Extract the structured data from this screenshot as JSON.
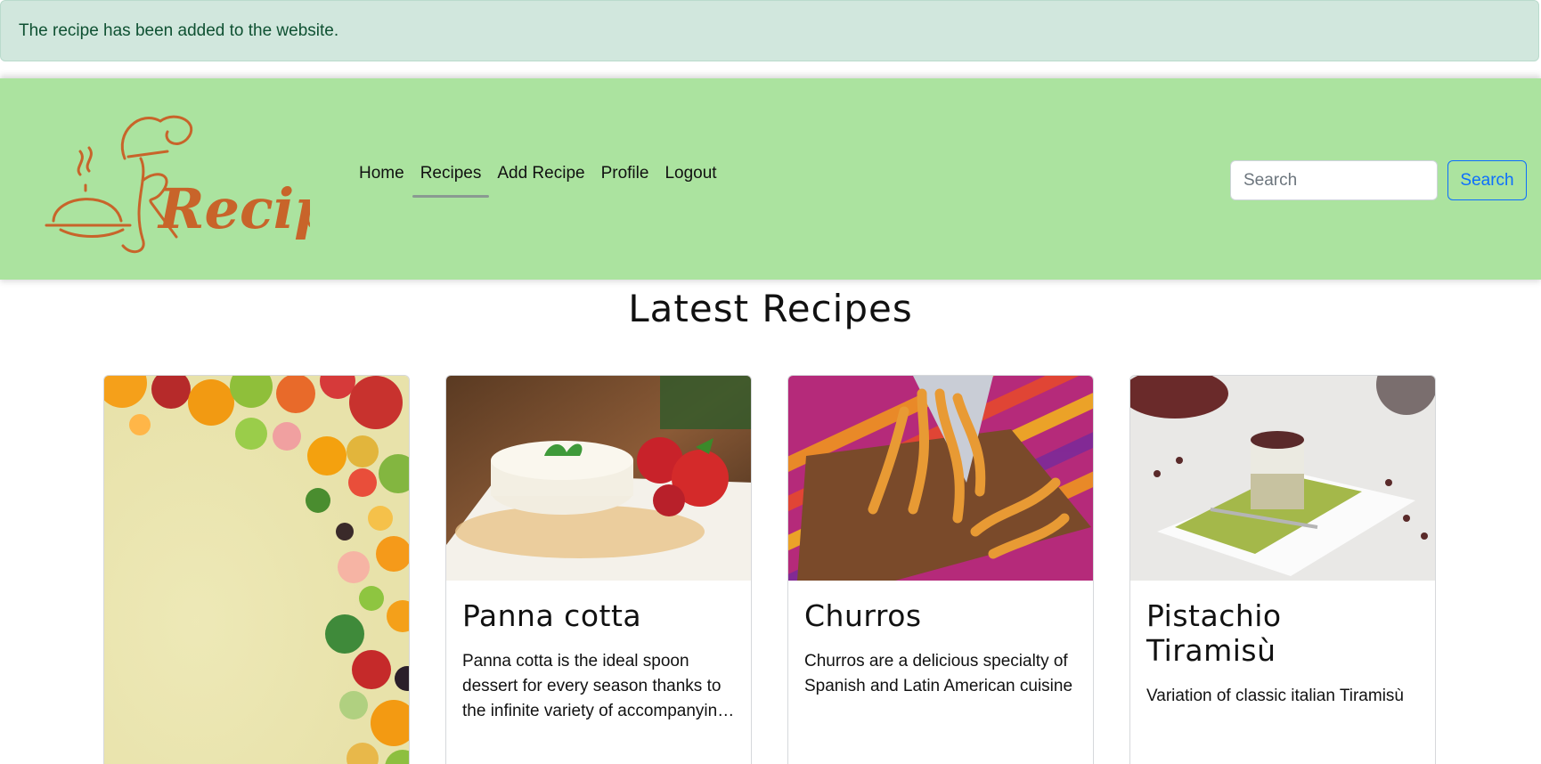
{
  "alert": {
    "message": "The recipe has been added to the website."
  },
  "brand": {
    "logo_text": "Recipes"
  },
  "nav": {
    "items": [
      {
        "label": "Home",
        "active": false
      },
      {
        "label": "Recipes",
        "active": true
      },
      {
        "label": "Add Recipe",
        "active": false
      },
      {
        "label": "Profile",
        "active": false
      },
      {
        "label": "Logout",
        "active": false
      }
    ]
  },
  "search": {
    "placeholder": "Search",
    "value": "",
    "button_label": "Search"
  },
  "main": {
    "title": "Latest Recipes",
    "cards": [
      {
        "title": "",
        "text": "",
        "image": "fruit-border-image"
      },
      {
        "title": "Panna cotta",
        "text": "Panna cotta is the ideal spoon dessert for every season thanks to the infinite variety of accompanying sauces and toppings",
        "image": "panna-cotta-image"
      },
      {
        "title": "Churros",
        "text": "Churros are a delicious specialty of Spanish and Latin American cuisine",
        "image": "churros-image"
      },
      {
        "title": "Pistachio Tiramisù",
        "text": "Variation of classic italian Tiramisù",
        "image": "tiramisu-image"
      }
    ]
  },
  "colors": {
    "alert_bg": "#d1e7dd",
    "alert_text": "#0f5132",
    "navbar_bg": "#abe39f",
    "logo": "#c8642a",
    "search_accent": "#0d6efd"
  }
}
